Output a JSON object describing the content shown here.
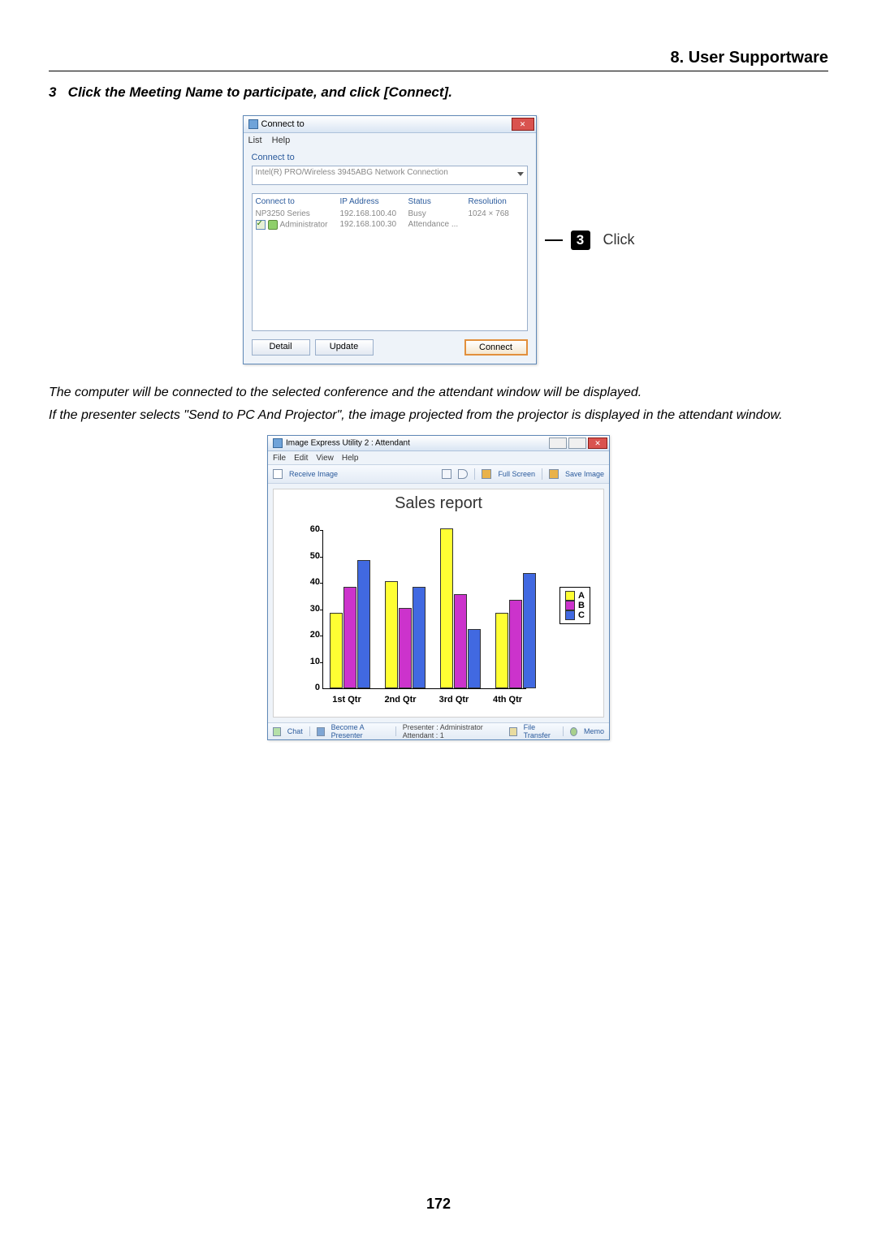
{
  "header": {
    "section_title": "8. User Supportware"
  },
  "step": {
    "number": "3",
    "text": "Click the Meeting Name to participate, and click [Connect]."
  },
  "callout": {
    "number": "3",
    "label": "Click"
  },
  "connect_window": {
    "title": "Connect to",
    "menu": [
      "List",
      "Help"
    ],
    "section_label": "Connect to",
    "dropdown_value": "Intel(R) PRO/Wireless 3945ABG Network Connection",
    "columns": [
      "Connect to",
      "IP Address",
      "Status",
      "Resolution"
    ],
    "rows": [
      {
        "checked": false,
        "has_icon": false,
        "name": "NP3250 Series",
        "ip": "192.168.100.40",
        "status": "Busy",
        "resolution": "1024 × 768"
      },
      {
        "checked": true,
        "has_icon": true,
        "name": "Administrator",
        "ip": "192.168.100.30",
        "status": "Attendance ...",
        "resolution": ""
      }
    ],
    "buttons": {
      "detail": "Detail",
      "update": "Update",
      "connect": "Connect"
    }
  },
  "body_paragraphs": [
    "The computer will be connected to the selected conference and the attendant window will be displayed.",
    "If the presenter selects \"Send to PC And Projector\", the image projected from the projector is displayed in the attendant window."
  ],
  "attendant_window": {
    "title": "Image Express Utility 2 : Attendant",
    "menu": [
      "File",
      "Edit",
      "View",
      "Help"
    ],
    "toolbar": {
      "receive": "Receive Image",
      "fullscreen": "Full Screen",
      "save": "Save Image"
    },
    "statusbar": {
      "chat": "Chat",
      "become": "Become A Presenter",
      "presenter_info": "Presenter : Administrator  Attendant : 1",
      "file_transfer": "File Transfer",
      "memo": "Memo"
    }
  },
  "chart_data": {
    "type": "bar",
    "title": "Sales report",
    "categories": [
      "1st Qtr",
      "2nd Qtr",
      "3rd Qtr",
      "4th Qtr"
    ],
    "series": [
      {
        "name": "A",
        "color": "#ffff33",
        "values": [
          28,
          40,
          60,
          28
        ]
      },
      {
        "name": "B",
        "color": "#cc33cc",
        "values": [
          38,
          30,
          35,
          33
        ]
      },
      {
        "name": "C",
        "color": "#4169e1",
        "values": [
          48,
          38,
          22,
          43
        ]
      }
    ],
    "yticks": [
      0,
      10,
      20,
      30,
      40,
      50,
      60
    ],
    "ylim": [
      0,
      60
    ],
    "xlabel": "",
    "ylabel": ""
  },
  "page_number": "172"
}
